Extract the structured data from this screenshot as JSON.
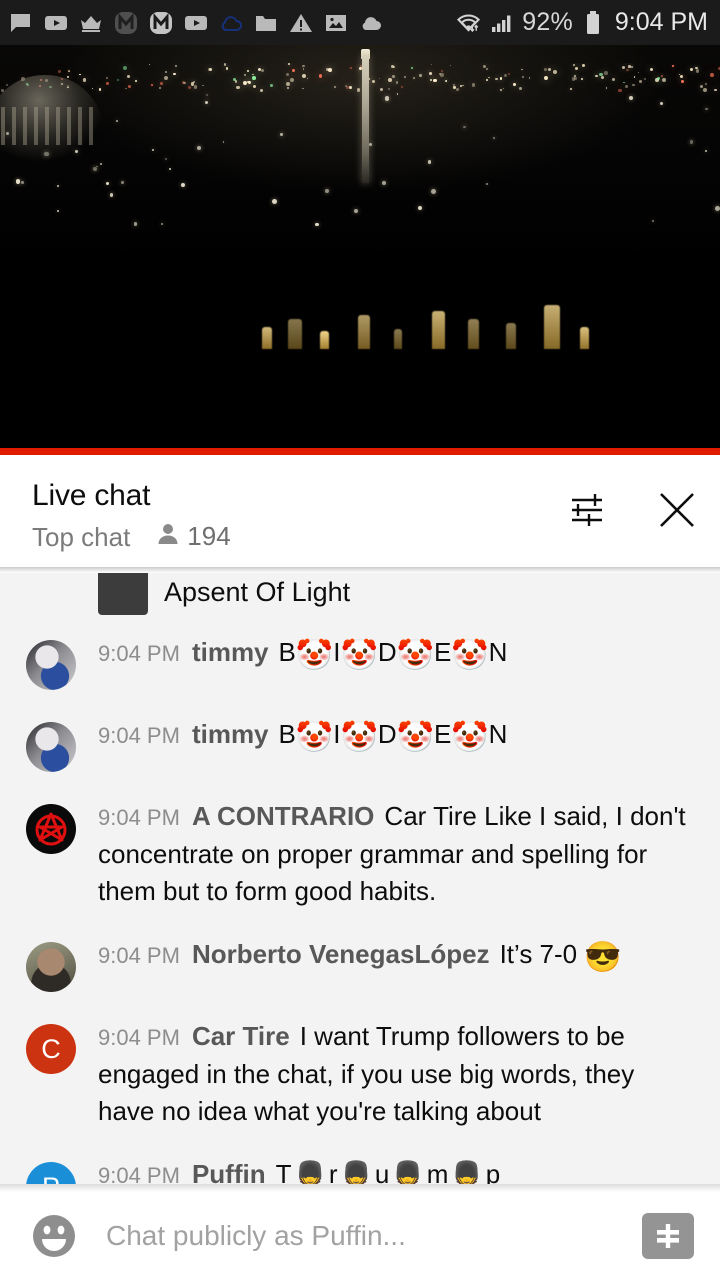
{
  "status_bar": {
    "icons": [
      "chat-bubble-icon",
      "youtube-icon",
      "crown-icon",
      "m-circle-dark-icon",
      "m-rounded-icon",
      "youtube-play-icon",
      "cloud-outline-icon",
      "folder-icon",
      "warning-triangle-icon",
      "photo-icon",
      "cloud-filled-icon"
    ],
    "wifi_icon": "wifi-data-icon",
    "signal_icon": "signal-bars-icon",
    "battery_percent": "92%",
    "battery_icon": "battery-icon",
    "time": "9:04 PM"
  },
  "video": {
    "name": "live-stream-night-cityscape",
    "progress_color": "#e01b00"
  },
  "chat_header": {
    "title": "Live chat",
    "subtitle": "Top chat",
    "viewer_icon": "person-icon",
    "viewer_count": "194",
    "settings_icon": "tune-sliders-icon",
    "close_icon": "close-x-icon"
  },
  "messages": [
    {
      "clipped": true,
      "avatar_type": "thumb-square",
      "avatar_text": "",
      "timestamp": "",
      "author": "",
      "text": "Apsent Of Light"
    },
    {
      "clipped": false,
      "avatar_type": "photo-toy",
      "avatar_text": "",
      "timestamp": "9:04 PM",
      "author": "timmy",
      "text": "B🤡I🤡D🤡E🤡N"
    },
    {
      "clipped": false,
      "avatar_type": "photo-toy",
      "avatar_text": "",
      "timestamp": "9:04 PM",
      "author": "timmy",
      "text": "B🤡I🤡D🤡E🤡N"
    },
    {
      "clipped": false,
      "avatar_type": "anarchy",
      "avatar_text": "",
      "timestamp": "9:04 PM",
      "author": "A CONTRARIO",
      "text": "Car Tire Like I said, I don't concentrate on proper grammar and spelling for them but to form good habits."
    },
    {
      "clipped": false,
      "avatar_type": "photo-man",
      "avatar_text": "",
      "timestamp": "9:04 PM",
      "author": "Norberto VenegasLópez",
      "text": "It’s 7-0 😎"
    },
    {
      "clipped": false,
      "avatar_type": "letter",
      "avatar_text": "C",
      "avatar_color": "#cc3311",
      "timestamp": "9:04 PM",
      "author": "Car Tire",
      "text": "I want Trump followers to be engaged in the chat, if you use big words, they have no idea what you're talking about"
    },
    {
      "clipped": false,
      "avatar_type": "letter",
      "avatar_text": "P",
      "avatar_color": "#1a8fd8",
      "timestamp": "9:04 PM",
      "author": "Puffin",
      "text": "T💂r💂u💂m💂p"
    }
  ],
  "input_bar": {
    "emoji_icon": "emoji-smiley-icon",
    "placeholder": "Chat publicly as Puffin...",
    "value": "",
    "superchat_icon": "dollar-superchat-icon"
  },
  "colors": {
    "accent_red": "#e01b00",
    "chat_background": "#f3f3f3",
    "header_background": "#ffffff",
    "timestamp_gray": "#8d8d8d",
    "author_gray": "#585858"
  }
}
